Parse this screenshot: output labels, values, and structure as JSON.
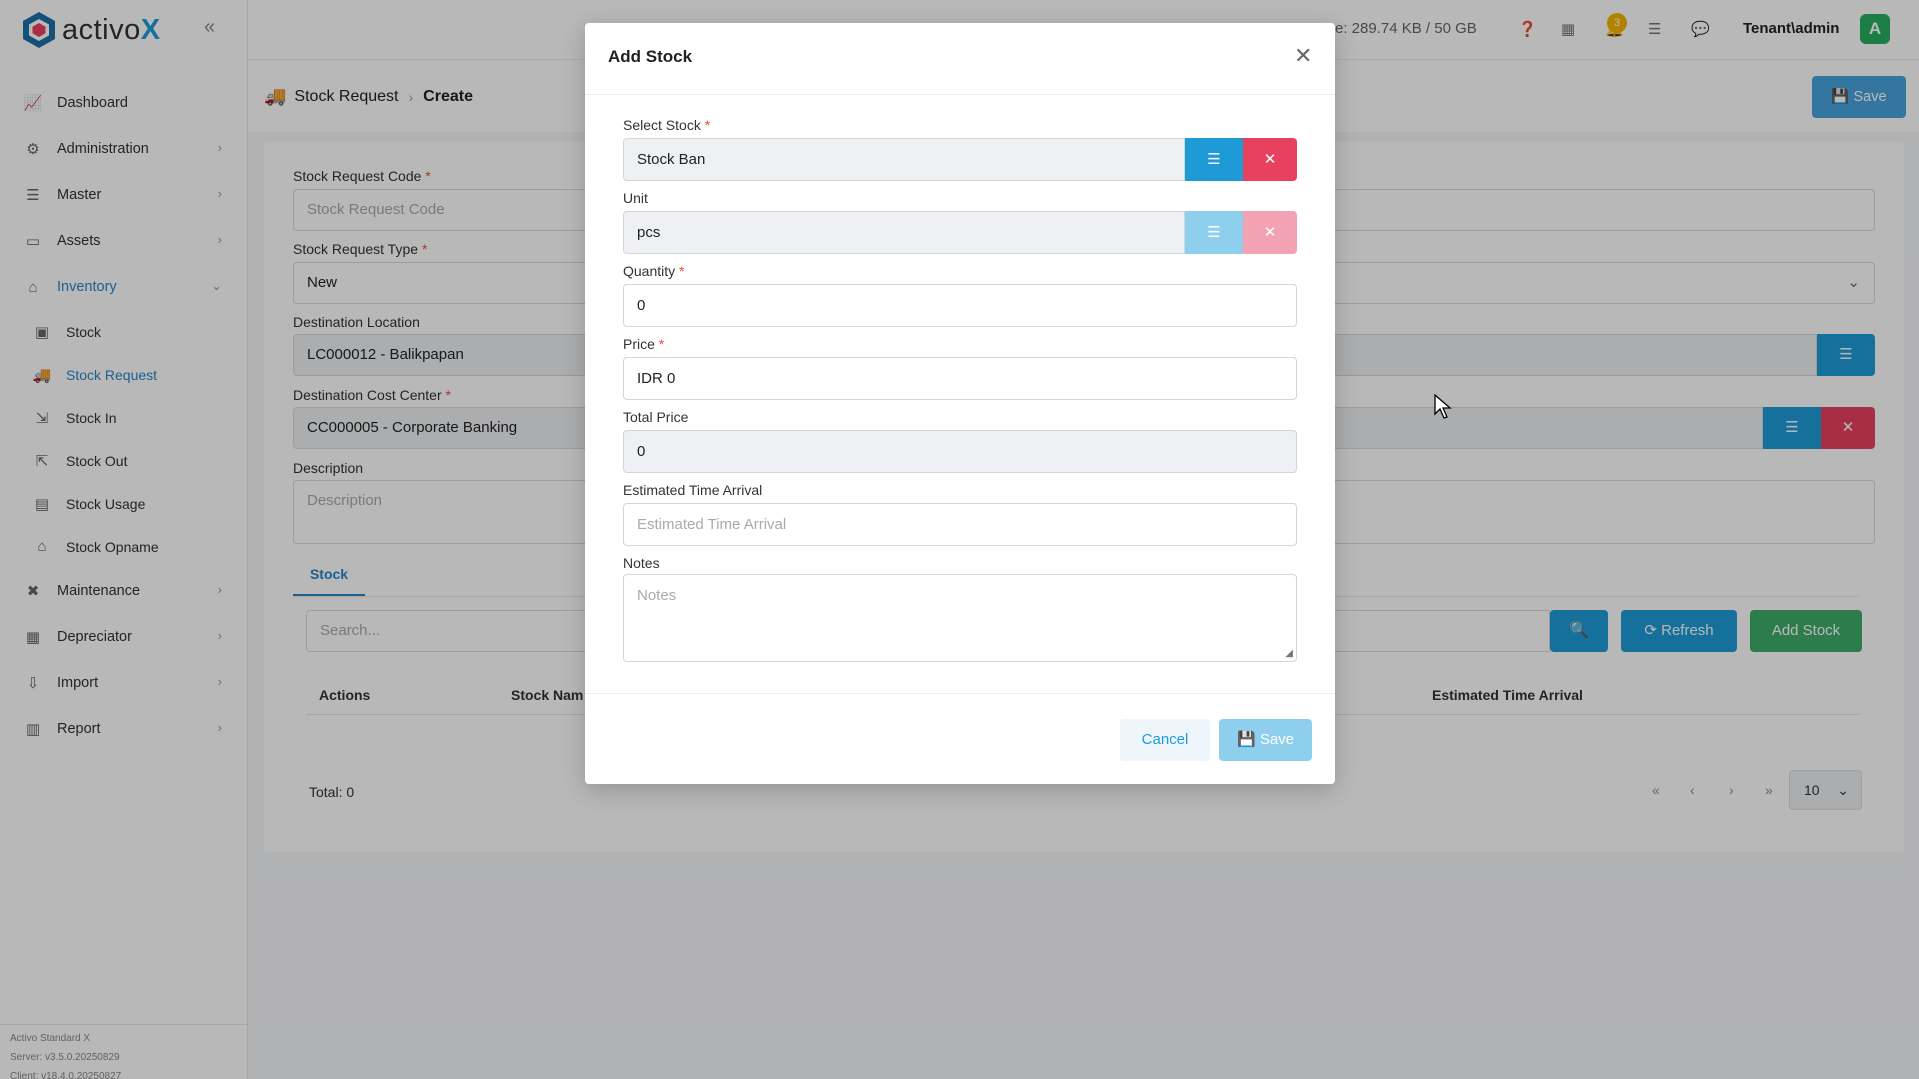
{
  "brand": {
    "name_prefix": "activo",
    "name_suffix": "X"
  },
  "topbar": {
    "storage": "e: 289.74 KB / 50 GB",
    "notif_count": "3",
    "tenant": "Tenant\\admin",
    "avatar_letter": "A"
  },
  "sidebar": {
    "items": [
      {
        "label": "Dashboard"
      },
      {
        "label": "Administration"
      },
      {
        "label": "Master"
      },
      {
        "label": "Assets"
      },
      {
        "label": "Inventory"
      },
      {
        "label": "Maintenance"
      },
      {
        "label": "Depreciator"
      },
      {
        "label": "Import"
      },
      {
        "label": "Report"
      }
    ],
    "inventory_sub": [
      {
        "label": "Stock"
      },
      {
        "label": "Stock Request"
      },
      {
        "label": "Stock In"
      },
      {
        "label": "Stock Out"
      },
      {
        "label": "Stock Usage"
      },
      {
        "label": "Stock Opname"
      }
    ],
    "footer": {
      "product": "Activo Standard X",
      "server": "Server: v3.5.0.20250829",
      "client": "Client: v18.4.0.20250827"
    }
  },
  "page": {
    "breadcrumb_parent": "Stock Request",
    "breadcrumb_current": "Create",
    "save_label": "Save"
  },
  "form": {
    "code_label": "Stock Request Code",
    "code_placeholder": "Stock Request Code",
    "type_label": "Stock Request Type",
    "type_value": "New",
    "dest_loc_label": "Destination Location",
    "dest_loc_value": "LC000012 - Balikpapan",
    "dest_cc_label": "Destination Cost Center",
    "dest_cc_value": "CC000005 - Corporate Banking",
    "desc_label": "Description",
    "desc_placeholder": "Description",
    "tab_stock": "Stock",
    "search_placeholder": "Search...",
    "refresh_label": "Refresh",
    "add_stock_label": "Add Stock",
    "table_headers": [
      "Actions",
      "Stock Nam",
      "Estimated Time Arrival"
    ],
    "total": "Total: 0",
    "page_size": "10"
  },
  "modal": {
    "title": "Add Stock",
    "select_stock_label": "Select Stock",
    "select_stock_value": "Stock Ban",
    "unit_label": "Unit",
    "unit_value": "pcs",
    "quantity_label": "Quantity",
    "quantity_value": "0",
    "price_label": "Price",
    "price_value": "IDR 0",
    "total_price_label": "Total Price",
    "total_price_value": "0",
    "eta_label": "Estimated Time Arrival",
    "eta_placeholder": "Estimated Time Arrival",
    "notes_label": "Notes",
    "notes_placeholder": "Notes",
    "cancel_label": "Cancel",
    "save_label": "Save"
  },
  "colors": {
    "primary": "#1e9bd7",
    "danger": "#e8405f",
    "success": "#3fae6a",
    "active_menu": "#2a86c8"
  }
}
